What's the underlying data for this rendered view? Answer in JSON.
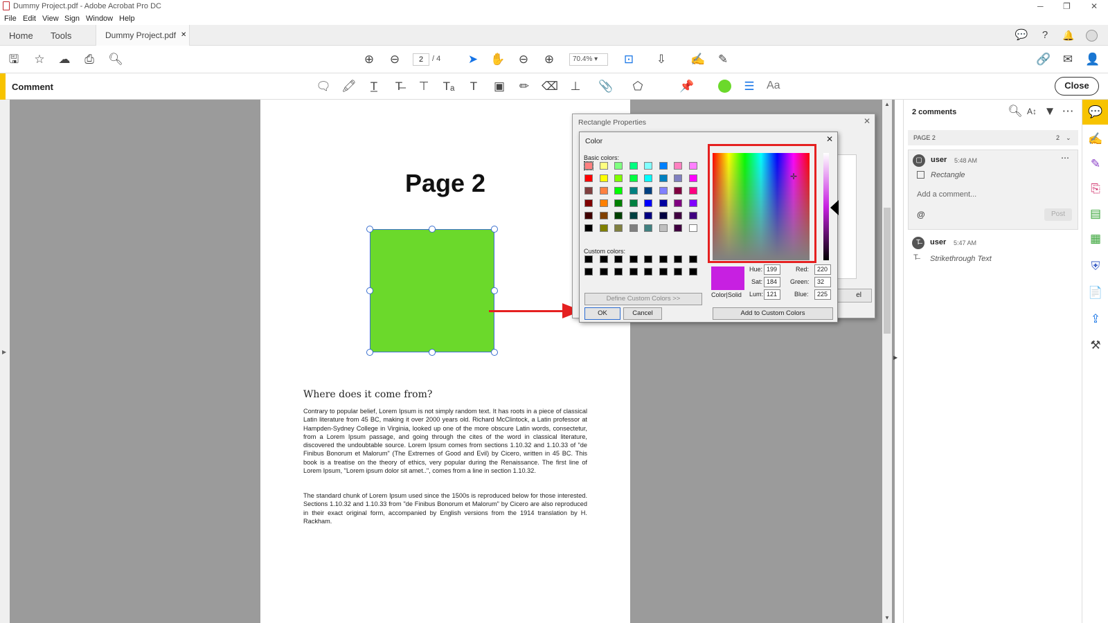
{
  "app": {
    "title": "Dummy Project.pdf - Adobe Acrobat Pro DC",
    "menu": [
      "File",
      "Edit",
      "View",
      "Sign",
      "Window",
      "Help"
    ]
  },
  "tabs": {
    "home": "Home",
    "tools": "Tools",
    "document": "Dummy Project.pdf",
    "close_glyph": "✕"
  },
  "toolbar": {
    "page_current": "2",
    "page_total": "/ 4",
    "zoom": "70.4%"
  },
  "comment_bar": {
    "label": "Comment",
    "close": "Close",
    "color_indicator": "#6bd92b",
    "font_tool": "Aa"
  },
  "document": {
    "heading": "Page 2",
    "rectangle_color": "#6bd92b",
    "subheading": "Where does it come from?",
    "paragraph1": "Contrary to popular belief, Lorem Ipsum is not simply random text. It has roots in a piece of classical Latin literature from 45 BC, making it over 2000 years old. Richard McClintock, a Latin professor at Hampden-Sydney College in Virginia, looked up one of the more obscure Latin words, consectetur, from a Lorem Ipsum passage, and going through the cites of the word in classical literature, discovered the undoubtable source. Lorem Ipsum comes from sections 1.10.32 and 1.10.33 of \"de Finibus Bonorum et Malorum\" (The Extremes of Good and Evil) by Cicero, written in 45 BC. This book is a treatise on the theory of ethics, very popular during the Renaissance. The first line of Lorem Ipsum, \"Lorem ipsum dolor sit amet..\", comes from a line in section 1.10.32.",
    "paragraph2": "The standard chunk of Lorem Ipsum used since the 1500s is reproduced below for those interested. Sections 1.10.32 and 1.10.33 from \"de Finibus Bonorum et Malorum\" by Cicero are also reproduced in their exact original form, accompanied by English versions from the 1914 translation by H. Rackham."
  },
  "rect_properties_dialog": {
    "title": "Rectangle Properties",
    "cancel_fragment": "el"
  },
  "color_dialog": {
    "title": "Color",
    "basic_colors_label": "Basic colors:",
    "custom_colors_label": "Custom colors:",
    "define_custom": "Define Custom Colors >>",
    "ok": "OK",
    "cancel": "Cancel",
    "color_solid": "Color|Solid",
    "add_custom": "Add to Custom Colors",
    "hue_label": "Hue:",
    "sat_label": "Sat:",
    "lum_label": "Lum:",
    "red_label": "Red:",
    "green_label": "Green:",
    "blue_label": "Blue:",
    "hue": "199",
    "sat": "184",
    "lum": "121",
    "red": "220",
    "green": "32",
    "blue": "225",
    "preview_color": "#c720e1",
    "basic_colors": [
      [
        "#ff8080",
        "#ffff80",
        "#80ff80",
        "#00ff80",
        "#80ffff",
        "#0080ff",
        "#ff80c0",
        "#ff80ff"
      ],
      [
        "#ff0000",
        "#ffff00",
        "#80ff00",
        "#00ff40",
        "#00ffff",
        "#0080c0",
        "#8080c0",
        "#ff00ff"
      ],
      [
        "#804040",
        "#ff8040",
        "#00ff00",
        "#008080",
        "#004080",
        "#8080ff",
        "#800040",
        "#ff0080"
      ],
      [
        "#800000",
        "#ff8000",
        "#008000",
        "#008040",
        "#0000ff",
        "#0000a0",
        "#800080",
        "#8000ff"
      ],
      [
        "#400000",
        "#804000",
        "#004000",
        "#004040",
        "#000080",
        "#000040",
        "#400040",
        "#400080"
      ],
      [
        "#000000",
        "#808000",
        "#808040",
        "#808080",
        "#408080",
        "#c0c0c0",
        "#400040",
        "#ffffff"
      ]
    ],
    "custom_colors": [
      [
        "#000000",
        "#000000",
        "#000000",
        "#000000",
        "#000000",
        "#000000",
        "#000000",
        "#000000"
      ],
      [
        "#000000",
        "#000000",
        "#000000",
        "#000000",
        "#000000",
        "#000000",
        "#000000",
        "#000000"
      ]
    ]
  },
  "comments_panel": {
    "count": "2 comments",
    "page_group": "PAGE 2",
    "page_group_count": "2",
    "comments": [
      {
        "user": "user",
        "time": "5:48 AM",
        "type": "Rectangle",
        "placeholder": "Add a comment...",
        "mention": "@",
        "post": "Post"
      },
      {
        "user": "user",
        "time": "5:47 AM",
        "type": "Strikethrough Text"
      }
    ]
  }
}
